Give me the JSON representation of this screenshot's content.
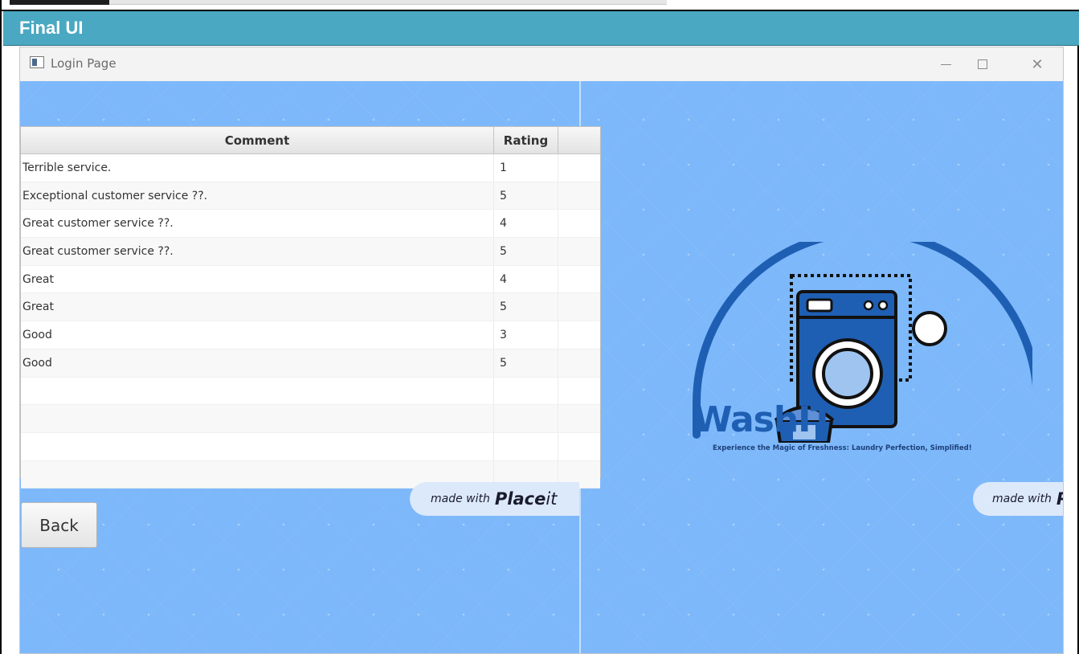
{
  "section_header": {
    "title": "Final UI"
  },
  "window": {
    "title": "Login Page",
    "controls": {
      "minimize": "minimize",
      "maximize": "maximize",
      "close": "close"
    }
  },
  "table": {
    "columns": [
      "Comment",
      "Rating",
      ""
    ],
    "rows": [
      {
        "comment": "Terrible service.",
        "rating": "1"
      },
      {
        "comment": "Exceptional customer service ??.",
        "rating": "5"
      },
      {
        "comment": "Great customer service ??.",
        "rating": "4"
      },
      {
        "comment": "Great customer service ??.",
        "rating": "5"
      },
      {
        "comment": "Great",
        "rating": "4"
      },
      {
        "comment": "Great",
        "rating": "5"
      },
      {
        "comment": "Good",
        "rating": "3"
      },
      {
        "comment": "Good",
        "rating": "5"
      },
      {
        "comment": "",
        "rating": ""
      },
      {
        "comment": "",
        "rating": ""
      },
      {
        "comment": "",
        "rating": ""
      },
      {
        "comment": "",
        "rating": ""
      }
    ]
  },
  "watermark": {
    "made_with": "made with",
    "brand_bold": "Place",
    "brand_italic": "it",
    "brand_cut": "P"
  },
  "back_button": {
    "label": "Back"
  },
  "logo": {
    "name": "WashIT",
    "tagline": "Experience the Magic of Freshness: Laundry Perfection, Simplified!"
  },
  "colors": {
    "header_bar": "#4aa8c2",
    "background": "#7db8fa",
    "logo_blue": "#1f5fb3",
    "logo_dark": "#111111"
  }
}
